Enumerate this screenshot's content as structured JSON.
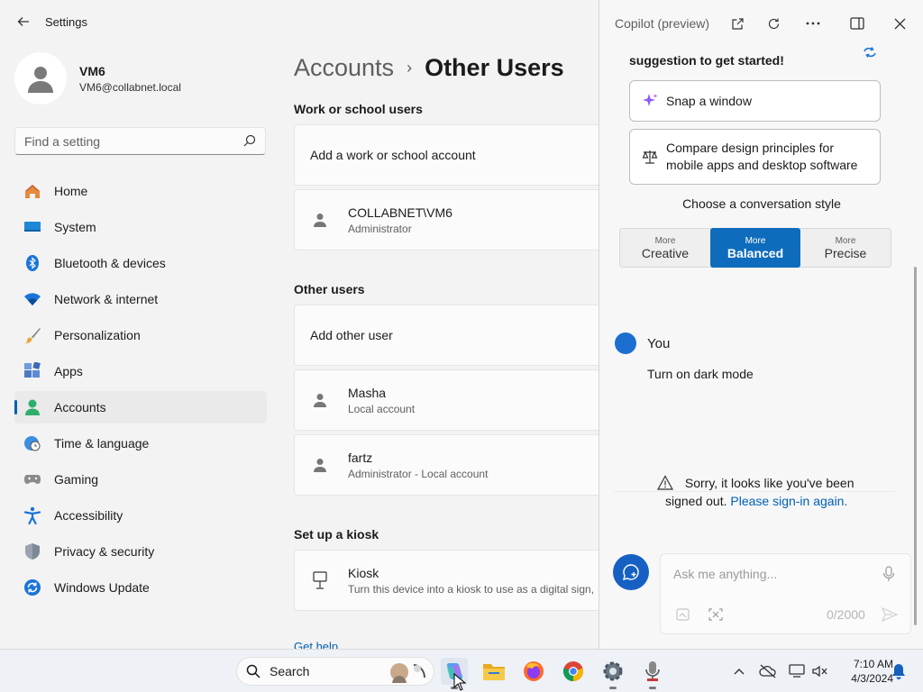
{
  "settings": {
    "app_title": "Settings",
    "profile": {
      "name": "VM6",
      "email": "VM6@collabnet.local"
    },
    "search_placeholder": "Find a setting",
    "nav": [
      {
        "label": "Home",
        "icon": "home-icon"
      },
      {
        "label": "System",
        "icon": "system-icon"
      },
      {
        "label": "Bluetooth & devices",
        "icon": "bluetooth-icon"
      },
      {
        "label": "Network & internet",
        "icon": "wifi-icon"
      },
      {
        "label": "Personalization",
        "icon": "brush-icon"
      },
      {
        "label": "Apps",
        "icon": "apps-icon"
      },
      {
        "label": "Accounts",
        "icon": "accounts-icon",
        "active": true
      },
      {
        "label": "Time & language",
        "icon": "globe-clock-icon"
      },
      {
        "label": "Gaming",
        "icon": "gamepad-icon"
      },
      {
        "label": "Accessibility",
        "icon": "accessibility-icon"
      },
      {
        "label": "Privacy & security",
        "icon": "shield-icon"
      },
      {
        "label": "Windows Update",
        "icon": "update-icon"
      }
    ],
    "breadcrumb": {
      "parent": "Accounts",
      "separator": "›",
      "current": "Other Users"
    },
    "work": {
      "title": "Work or school users",
      "add_label": "Add a work or school account",
      "user": {
        "name": "COLLABNET\\VM6",
        "sub": "Administrator"
      }
    },
    "other": {
      "title": "Other users",
      "add_label": "Add other user",
      "users": [
        {
          "name": "Masha",
          "sub": "Local account"
        },
        {
          "name": "fartz",
          "sub": "Administrator - Local account"
        }
      ]
    },
    "kiosk": {
      "title": "Set up a kiosk",
      "name": "Kiosk",
      "sub": "Turn this device into a kiosk to use as a digital sign,"
    },
    "get_help": "Get help"
  },
  "copilot": {
    "title": "Copilot (preview)",
    "intro": "suggestion to get started!",
    "suggestions": [
      {
        "label": "Snap a window",
        "icon": "sparkle-icon"
      },
      {
        "label": "Compare design principles for mobile apps and desktop software",
        "icon": "scales-icon"
      }
    ],
    "style_title": "Choose a conversation style",
    "styles": [
      {
        "small": "More",
        "big": "Creative"
      },
      {
        "small": "More",
        "big": "Balanced",
        "selected": true
      },
      {
        "small": "More",
        "big": "Precise"
      }
    ],
    "you_label": "You",
    "you_message": "Turn on dark mode",
    "signout_text": "Sorry, it looks like you've been signed out.",
    "signin_link": "Please sign-in again.",
    "ask_placeholder": "Ask me anything...",
    "counter": "0/2000",
    "accent": "#0f6cbd"
  },
  "taskbar": {
    "search_label": "Search",
    "time": "7:10 AM",
    "date": "4/3/2024"
  }
}
